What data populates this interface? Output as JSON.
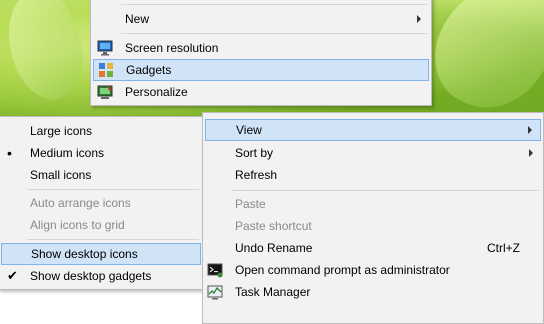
{
  "top_menu": {
    "items": [
      {
        "label": "New"
      },
      {
        "label": "Screen resolution",
        "icon": "monitor-icon"
      },
      {
        "label": "Gadgets",
        "icon": "gadgets-icon"
      },
      {
        "label": "Personalize",
        "icon": "personalize-icon"
      }
    ]
  },
  "view_submenu": {
    "items": [
      {
        "label": "Large icons"
      },
      {
        "label": "Medium icons",
        "marker": "•"
      },
      {
        "label": "Small icons"
      },
      {
        "label": "Auto arrange icons"
      },
      {
        "label": "Align icons to grid"
      },
      {
        "label": "Show desktop icons"
      },
      {
        "label": "Show desktop gadgets",
        "marker": "✔"
      }
    ]
  },
  "main_menu": {
    "items": [
      {
        "label": "View"
      },
      {
        "label": "Sort by"
      },
      {
        "label": "Refresh"
      },
      {
        "label": "Paste"
      },
      {
        "label": "Paste shortcut"
      },
      {
        "label": "Undo Rename",
        "shortcut": "Ctrl+Z"
      },
      {
        "label": "Open command prompt as administrator",
        "icon": "command-prompt-icon"
      },
      {
        "label": "Task Manager",
        "icon": "task-manager-icon"
      }
    ]
  },
  "colors": {
    "highlight": "#d1e3f7",
    "highlight_border": "#7eb4ea",
    "menu_bg": "#f2f2f2",
    "disabled_text": "#8a8a8a"
  }
}
